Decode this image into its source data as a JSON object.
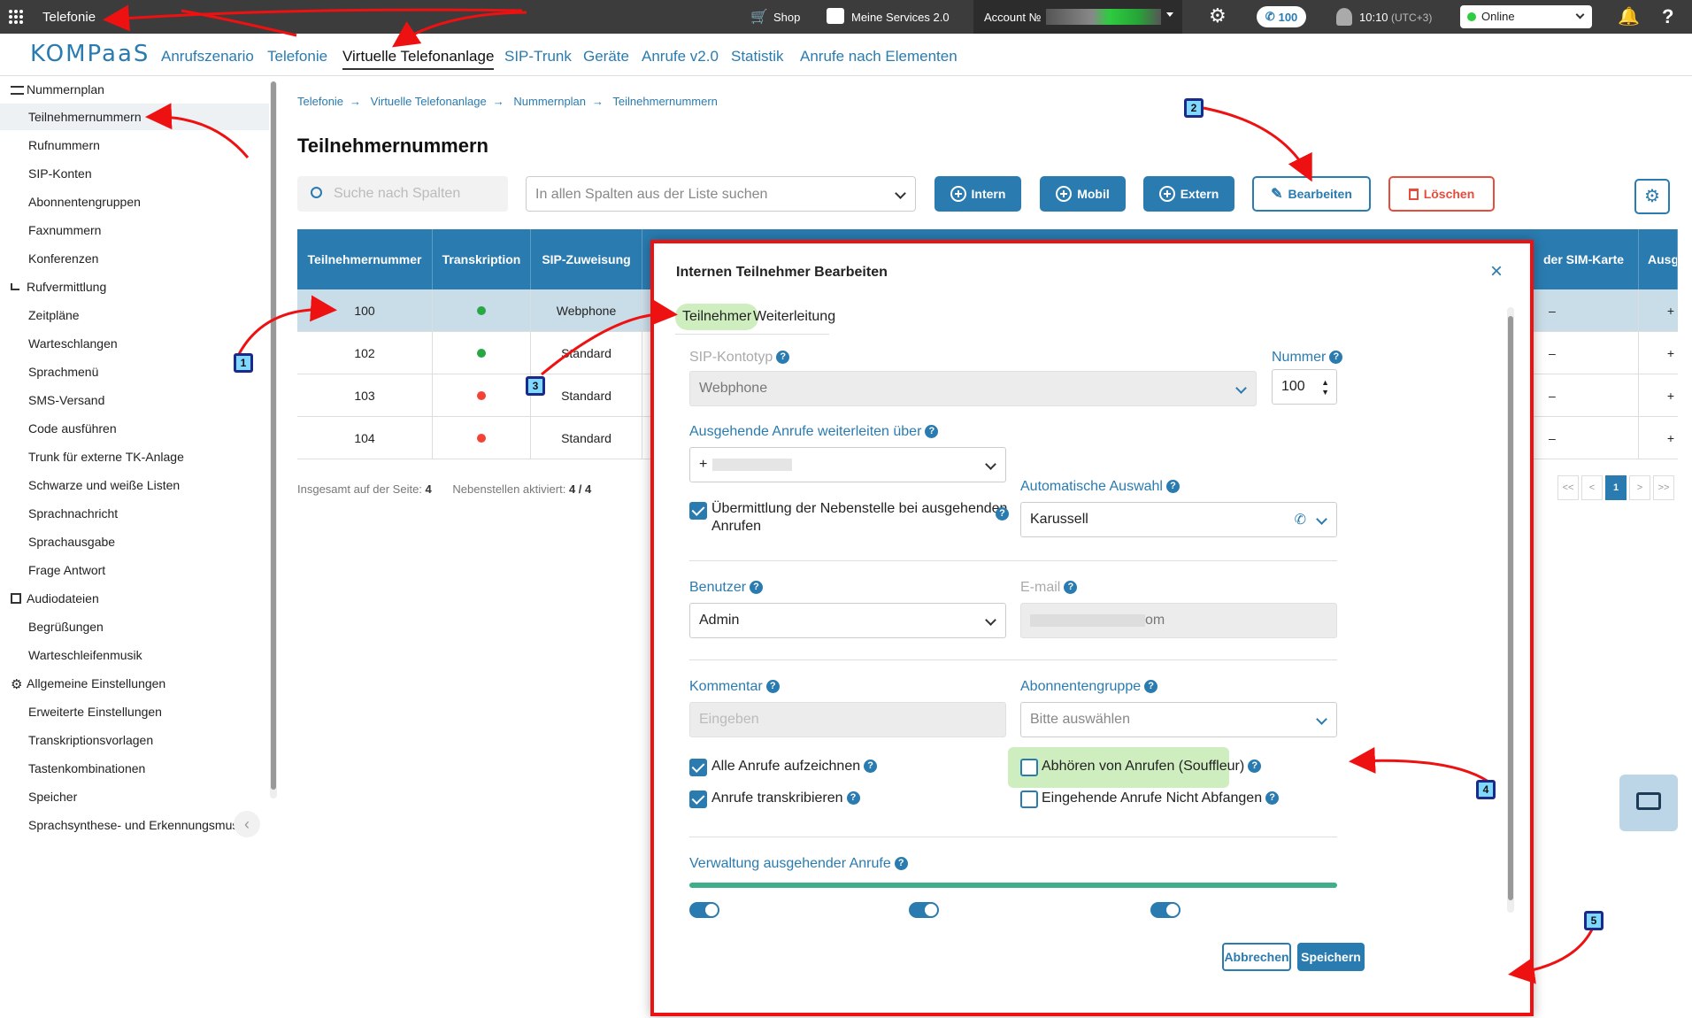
{
  "topbar": {
    "app_name": "Telefonie",
    "shop": "Shop",
    "services": "Meine Services 2.0",
    "account_label": "Account №",
    "calls_count": "100",
    "time": "10:10",
    "timezone": "(UTC+3)",
    "status": "Online"
  },
  "nav": {
    "brand": "KOMPaaS",
    "items": [
      "Anrufszenario",
      "Telefonie",
      "Virtuelle Telefonanlage",
      "SIP-Trunk",
      "Geräte",
      "Anrufe v2.0",
      "Statistik",
      "Anrufe nach Elementen"
    ]
  },
  "sidebar": {
    "sections": [
      {
        "title": "Nummernplan",
        "items": [
          "Teilnehmernummern",
          "Rufnummern",
          "SIP-Konten",
          "Abonnentengruppen",
          "Faxnummern",
          "Konferenzen"
        ]
      },
      {
        "title": "Rufvermittlung",
        "items": [
          "Zeitpläne",
          "Warteschlangen",
          "Sprachmenü",
          "SMS-Versand",
          "Code ausführen",
          "Trunk für externe TK-Anlage",
          "Schwarze und weiße Listen",
          "Sprachnachricht",
          "Sprachausgabe",
          "Frage Antwort"
        ]
      },
      {
        "title": "Audiodateien",
        "items": [
          "Begrüßungen",
          "Warteschleifenmusik"
        ]
      },
      {
        "title": "Allgemeine Einstellungen",
        "items": [
          "Erweiterte Einstellungen",
          "Transkriptionsvorlagen",
          "Tastenkombinationen",
          "Speicher",
          "Sprachsynthese- und Erkennungsmus"
        ]
      }
    ]
  },
  "breadcrumb": [
    "Telefonie",
    "Virtuelle Telefonanlage",
    "Nummernplan",
    "Teilnehmernummern"
  ],
  "page_title": "Teilnehmernummern",
  "toolbar": {
    "search_placeholder": "Suche nach Spalten",
    "all_columns_placeholder": "In allen Spalten aus der Liste suchen",
    "intern": "Intern",
    "mobil": "Mobil",
    "extern": "Extern",
    "edit": "Bearbeiten",
    "delete": "Löschen"
  },
  "table": {
    "headers": [
      "Teilnehmernummer",
      "Transkription",
      "SIP-Zuweisung"
    ],
    "right_headers": [
      "der SIM-Karte",
      "Ausg"
    ],
    "rows": [
      {
        "number": "100",
        "status": "green",
        "sip": "Webphone",
        "c1": "–",
        "c2": "+"
      },
      {
        "number": "102",
        "status": "green",
        "sip": "Standard",
        "c1": "–",
        "c2": "+"
      },
      {
        "number": "103",
        "status": "red",
        "sip": "Standard",
        "c1": "–",
        "c2": "+"
      },
      {
        "number": "104",
        "status": "red",
        "sip": "Standard",
        "c1": "–",
        "c2": "+"
      }
    ],
    "footer_total_label": "Insgesamt auf der Seite:",
    "footer_total": "4",
    "footer_ext_label": "Nebenstellen aktiviert:",
    "footer_ext": "4 / 4",
    "pages": [
      "<<",
      "<",
      "1",
      ">",
      ">>"
    ]
  },
  "modal": {
    "title": "Internen Teilnehmer Bearbeiten",
    "tabs": [
      "Teilnehmer",
      "Weiterleitung"
    ],
    "sip_type_label": "SIP-Kontotyp",
    "sip_type_value": "Webphone",
    "number_label": "Nummer",
    "number_value": "100",
    "outgoing_label": "Ausgehende Anrufe weiterleiten über",
    "outgoing_value": "+",
    "auto_label": "Automatische Auswahl",
    "auto_value": "Karussell",
    "transmit_line1": "Übermittlung der Nebenstelle bei ausgehenden",
    "transmit_line2": "Anrufen",
    "user_label": "Benutzer",
    "user_value": "Admin",
    "email_label": "E-mail",
    "email_value": "om",
    "comment_label": "Kommentar",
    "comment_placeholder": "Eingeben",
    "group_label": "Abonnentengruppe",
    "group_placeholder": "Bitte auswählen",
    "record_all": "Alle Anrufe aufzeichnen",
    "transcribe": "Anrufe transkribieren",
    "souffleur": "Abhören von Anrufen (Souffleur)",
    "no_intercept": "Eingehende Anrufe Nicht Abfangen",
    "outgoing_mgmt": "Verwaltung ausgehender Anrufe",
    "cancel": "Abbrechen",
    "save": "Speichern"
  },
  "markers": [
    "1",
    "2",
    "3",
    "4",
    "5"
  ],
  "colors": {
    "accent": "#2a7bb0",
    "highlight": "#e11111",
    "arrow": "#e11111",
    "marker": "#7fd8ff"
  }
}
